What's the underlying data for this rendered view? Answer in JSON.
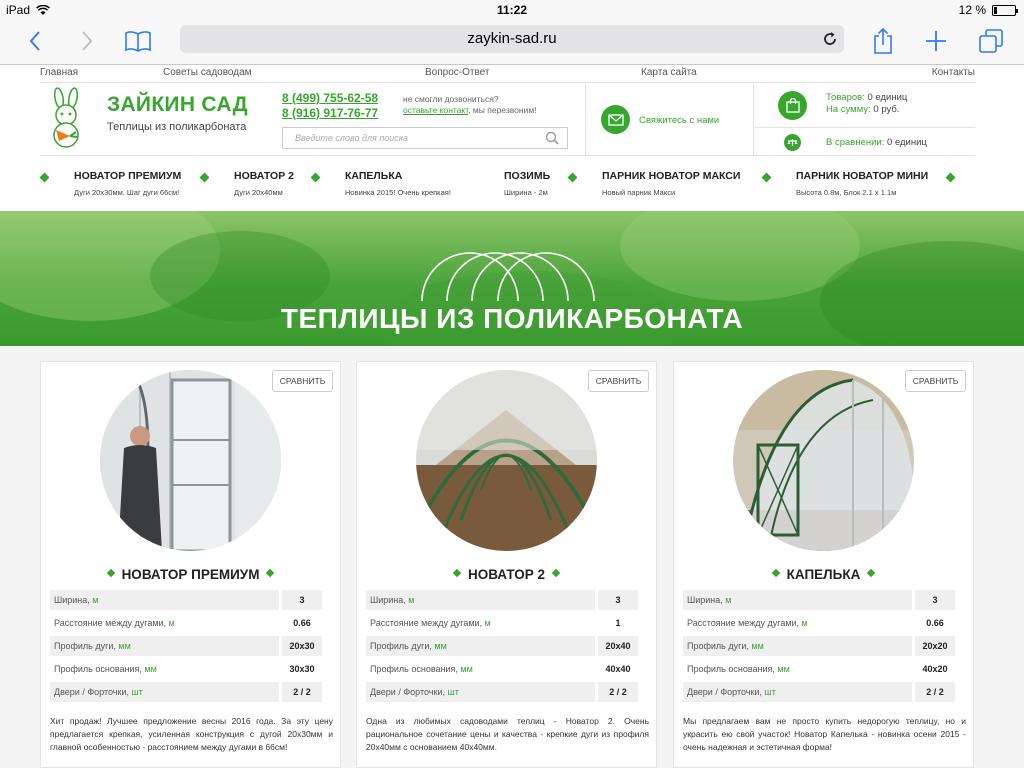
{
  "status_bar": {
    "device": "iPad",
    "time": "11:22",
    "battery": "12 %",
    "battery_level": 0.12
  },
  "browser": {
    "url": "zaykin-sad.ru"
  },
  "top_nav": [
    "Главная",
    "Советы садоводам",
    "Вопрос-Ответ",
    "Карта сайта",
    "Контакты"
  ],
  "header": {
    "logo_title": "ЗАЙКИН САД",
    "logo_subtitle": "Теплицы из поликарбоната",
    "phone1": "8 (499) 755-62-58",
    "phone2": "8 (916) 917-76-77",
    "callback_q": "не смогли дозвониться?",
    "callback_link": "оставьте контакт",
    "callback_tail": ", мы перезвоним!",
    "search_placeholder": "Введите слово для поиска",
    "contact_us": "Свяжитесь с нами",
    "goods_label": "Товаров:",
    "goods_value": "0 единиц",
    "sum_label": "На сумму:",
    "sum_value": "0 руб.",
    "compare_label": "В сравнении:",
    "compare_value": "0 единиц"
  },
  "product_nav": [
    {
      "title": "НОВАТОР ПРЕМИУМ",
      "sub": "Дуги 20х30мм. Шаг дуги 66см!"
    },
    {
      "title": "НОВАТОР 2",
      "sub": "Дуги 20х40мм"
    },
    {
      "title": "КАПЕЛЬКА",
      "sub": "Новинка 2015! Очень крепкая!"
    },
    {
      "title": "ПОЗИМЬ",
      "sub": "Ширина - 2м"
    },
    {
      "title": "ПАРНИК НОВАТОР МАКСИ",
      "sub": "Новый парник Макси"
    },
    {
      "title": "ПАРНИК НОВАТОР МИНИ",
      "sub": "Высота 0.8м, Блок 2.1 х 1.1м"
    }
  ],
  "hero": {
    "title": "ТЕПЛИЦЫ ИЗ ПОЛИКАРБОНАТА"
  },
  "compare_button": "СРАВНИТЬ",
  "cards": [
    {
      "title": "НОВАТОР ПРЕМИУМ",
      "specs": [
        {
          "name": "Ширина, ",
          "unit": "м",
          "value": "3"
        },
        {
          "name": "Расстояние между дугами, ",
          "unit": "м",
          "value": "0.66"
        },
        {
          "name": "Профиль дуги, ",
          "unit": "мм",
          "value": "20х30"
        },
        {
          "name": "Профиль основания, ",
          "unit": "мм",
          "value": "30х30"
        },
        {
          "name": "Двери / Форточки, ",
          "unit": "шт",
          "value": "2 / 2"
        }
      ],
      "description": "Хит продаж! Лучшее предложение весны 2016 года. За эту цену предлагается крепкая, усиленная конструкция с дугой 20х30мм и главной особенностью - расстоянием между дугами в 66см!"
    },
    {
      "title": "НОВАТОР 2",
      "specs": [
        {
          "name": "Ширина, ",
          "unit": "м",
          "value": "3"
        },
        {
          "name": "Расстояние между дугами, ",
          "unit": "м",
          "value": "1"
        },
        {
          "name": "Профиль дуги, ",
          "unit": "мм",
          "value": "20х40"
        },
        {
          "name": "Профиль основания, ",
          "unit": "мм",
          "value": "40х40"
        },
        {
          "name": "Двери / Форточки, ",
          "unit": "шт",
          "value": "2 / 2"
        }
      ],
      "description": "Одна из любимых садоводами теплиц - Новатор 2. Очень рациональное сочетание цены и качества - крепкие дуги из профиля 20х40мм с основанием 40х40мм."
    },
    {
      "title": "КАПЕЛЬКА",
      "specs": [
        {
          "name": "Ширина, ",
          "unit": "м",
          "value": "3"
        },
        {
          "name": "Расстояние между дугами, ",
          "unit": "м",
          "value": "0.66"
        },
        {
          "name": "Профиль дуги, ",
          "unit": "мм",
          "value": "20х20"
        },
        {
          "name": "Профиль основания, ",
          "unit": "мм",
          "value": "40х20"
        },
        {
          "name": "Двери / Форточки, ",
          "unit": "шт",
          "value": "2 / 2"
        }
      ],
      "description": "Мы предлагаем вам не просто купить недорогую теплицу, но и украсить ею свой участок! Новатор Капелька - новинка осени 2015 - очень надежная и эстетичная форма!"
    }
  ],
  "colors": {
    "brand_green": "#36a62c",
    "hero_green": "#4aa33a",
    "safari_blue": "#2f7cf6"
  }
}
